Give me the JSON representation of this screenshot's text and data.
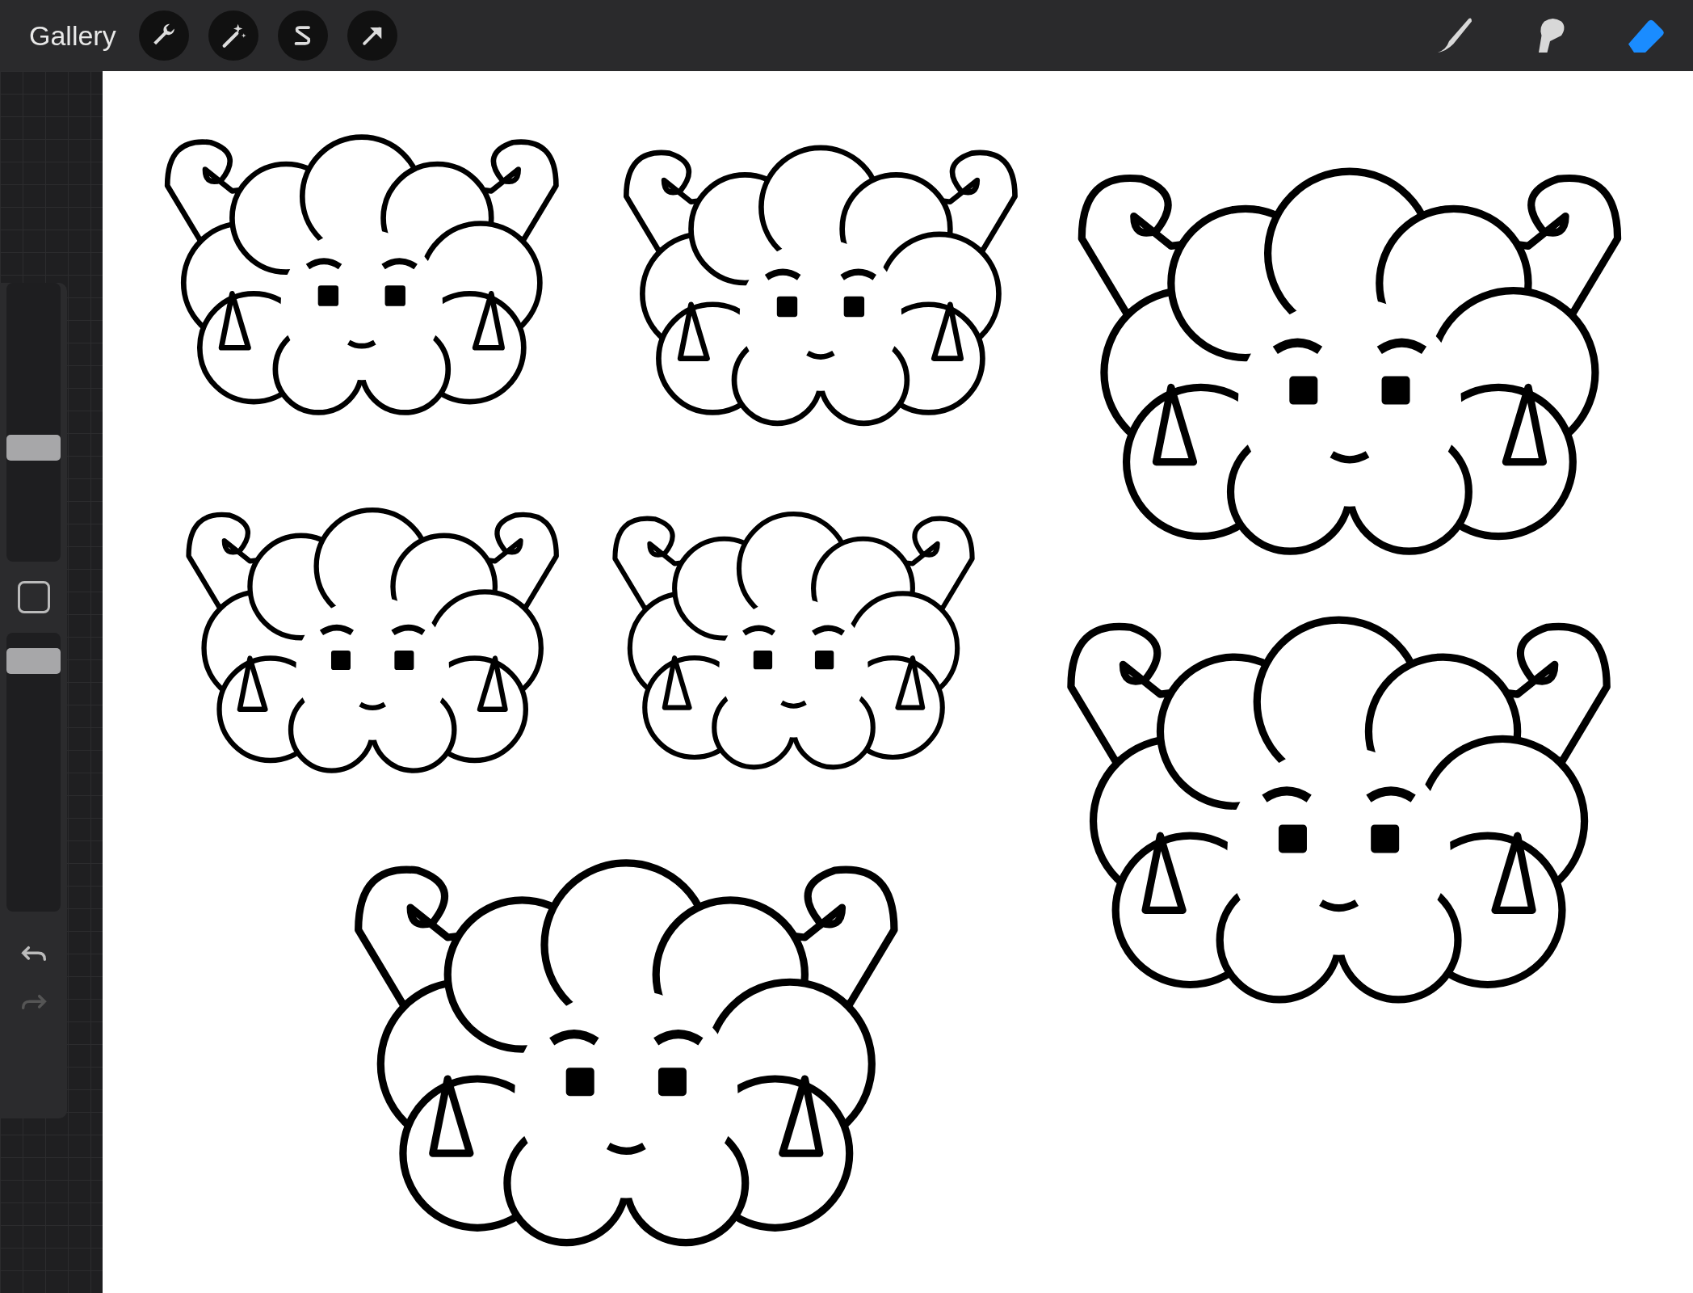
{
  "top_bar": {
    "gallery_label": "Gallery"
  },
  "tools": [
    {
      "kind": "brush",
      "selected": false
    },
    {
      "kind": "smudge",
      "selected": false
    },
    {
      "kind": "eraser",
      "selected": true
    }
  ],
  "sidebar": {
    "brush_size": {
      "level": 0.4
    },
    "opacity": {
      "level": 0.94
    },
    "history": [
      {
        "kind": "undo",
        "disabled": false
      },
      {
        "kind": "redo",
        "disabled": true
      }
    ]
  }
}
